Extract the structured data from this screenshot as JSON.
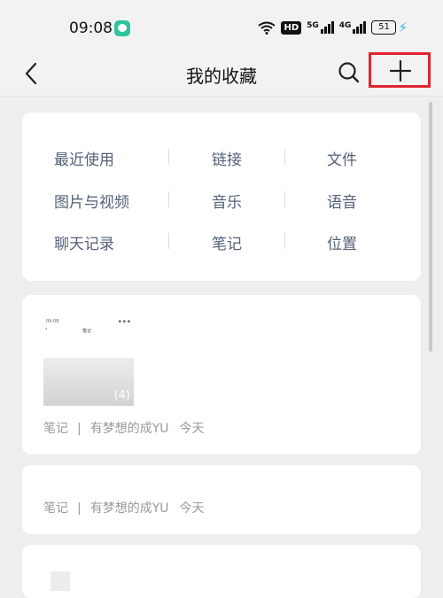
{
  "status_bar": {
    "time": "09:08",
    "hd": "HD",
    "signal1": "5G",
    "signal2": "4G",
    "battery": "51"
  },
  "nav": {
    "title": "我的收藏"
  },
  "categories": [
    {
      "label": "最近使用"
    },
    {
      "label": "链接"
    },
    {
      "label": "文件"
    },
    {
      "label": "图片与视频"
    },
    {
      "label": "音乐"
    },
    {
      "label": "语音"
    },
    {
      "label": "聊天记录"
    },
    {
      "label": "笔记"
    },
    {
      "label": "位置"
    }
  ],
  "items": [
    {
      "thumbnail": {
        "count": "(4)",
        "mini_time": "09:08",
        "mini_title": "笔记"
      },
      "type": "笔记",
      "separator": "|",
      "author": "有梦想的成YU",
      "time": "今天"
    },
    {
      "type": "笔记",
      "separator": "|",
      "author": "有梦想的成YU",
      "time": "今天"
    }
  ],
  "colors": {
    "highlight": "#e0242f",
    "category_text": "#556079",
    "meta_text": "#9a9a9a"
  }
}
